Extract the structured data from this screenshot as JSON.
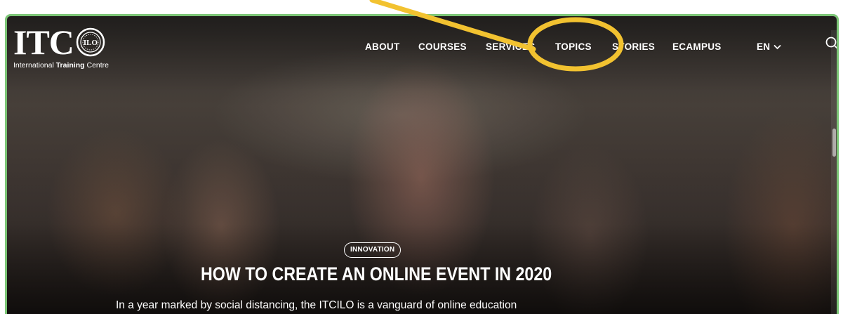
{
  "brand": {
    "logo_text": "ITC",
    "seal_text": "ILO",
    "subtitle_plain": "International ",
    "subtitle_bold": "Training",
    "subtitle_end": " Centre"
  },
  "nav": {
    "items": [
      "ABOUT",
      "COURSES",
      "SERVICES",
      "TOPICS",
      "STORIES",
      "ECAMPUS"
    ],
    "language": "EN"
  },
  "hero": {
    "tag": "INNOVATION",
    "headline": "HOW TO CREATE AN ONLINE EVENT IN 2020",
    "subtitle": "In a year marked by social distancing, the ITCILO is a vanguard of online education"
  },
  "icons": {
    "search": "search-icon",
    "chevron": "chevron-down-icon",
    "seal": "ilo-seal-icon"
  },
  "colors": {
    "annotation": "#f2c230",
    "frame_border": "#7cc576",
    "text": "#ffffff"
  }
}
